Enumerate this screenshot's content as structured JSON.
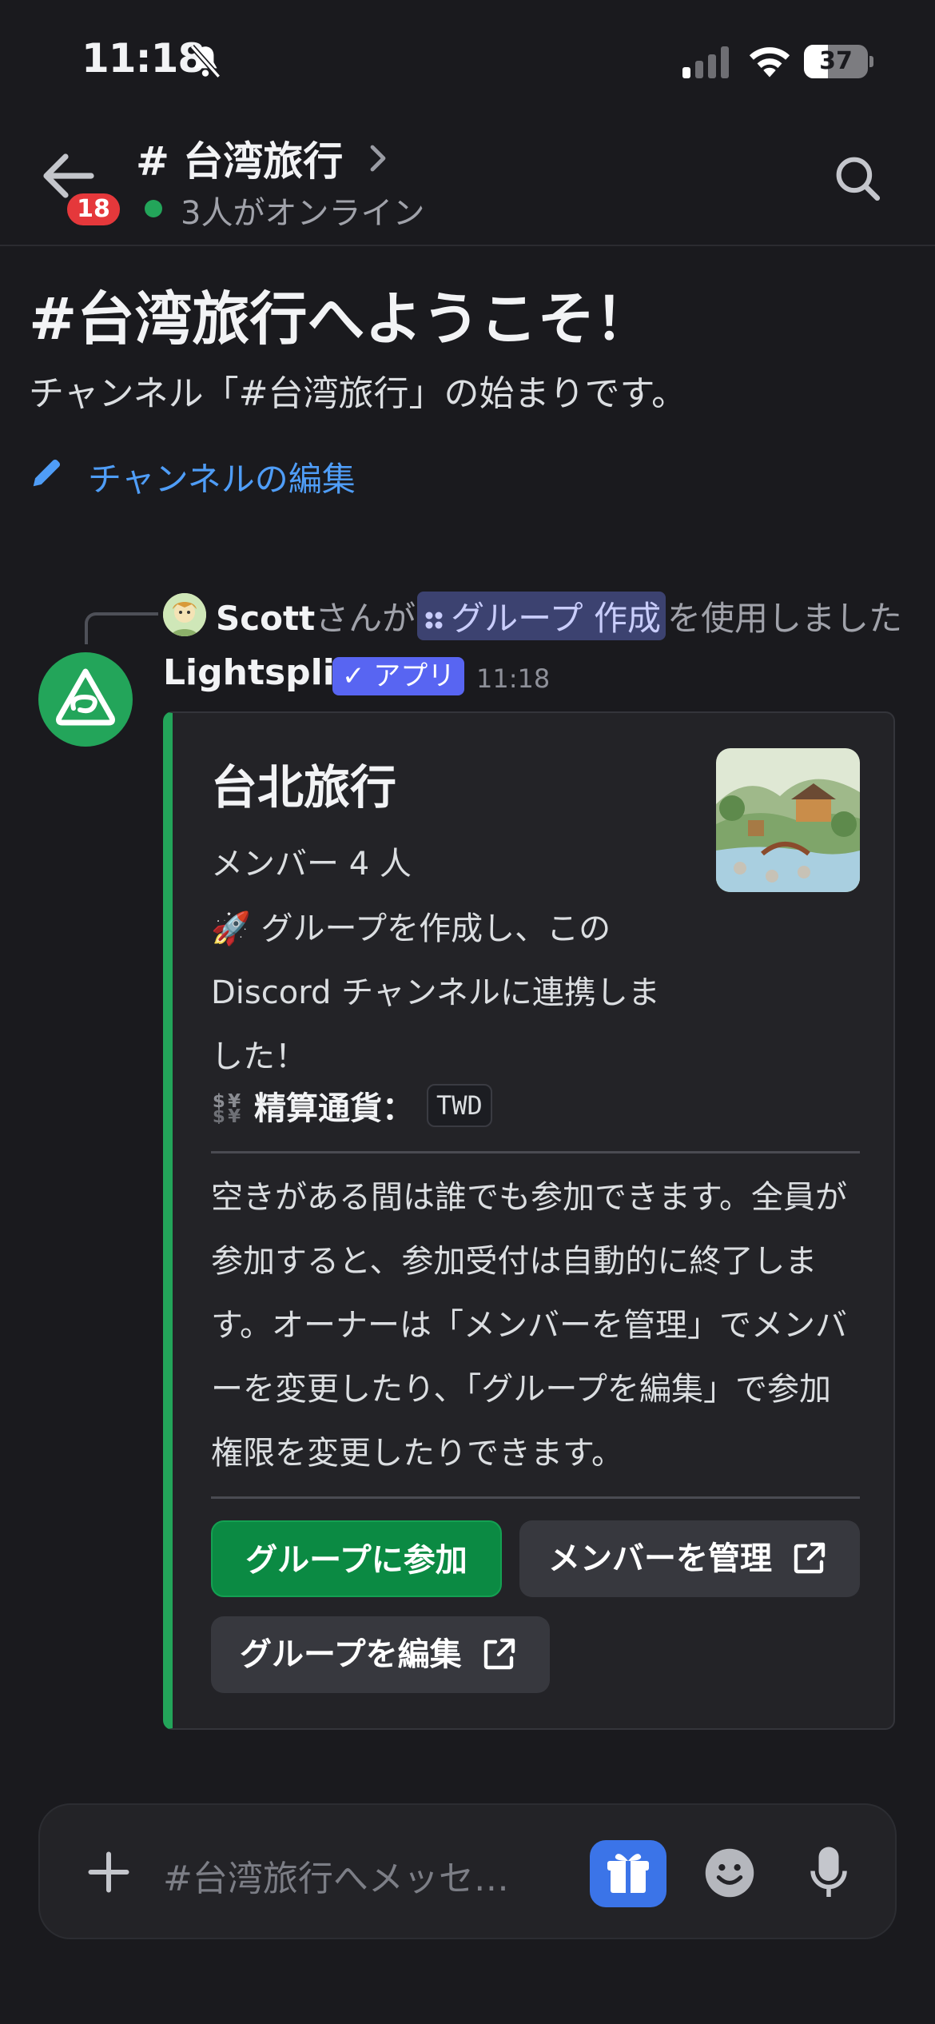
{
  "status_bar": {
    "time": "11:18",
    "battery": "37",
    "battery_level": 0.37
  },
  "header": {
    "unread_badge": "18",
    "channel_title": "# 台湾旅行",
    "online_text": "3人がオンライン"
  },
  "welcome": {
    "title": "#台湾旅行へようこそ！",
    "subtitle": "チャンネル「#台湾旅行」の始まりです。",
    "edit_link": "チャンネルの編集"
  },
  "system_line": {
    "user": "Scott",
    "suffix_1": "さんが",
    "command": "グループ 作成",
    "suffix_2": "を使用しました"
  },
  "message": {
    "author": "Lightsplit",
    "app_tag": "✓ アプリ",
    "time": "11:18",
    "embed": {
      "title": "台北旅行",
      "members": "メンバー 4 人",
      "description": "🚀 グループを作成し、この Discord チャンネルに連携しました！",
      "field_label": "精算通貨：",
      "field_value": "TWD",
      "body": "空きがある間は誰でも参加できます。全員が参加すると、参加受付は自動的に終了します。オーナーは「メンバーを管理」でメンバーを変更したり、「グループを編集」で参加権限を変更したりできます。",
      "buttons": {
        "join": "グループに参加",
        "manage": "メンバーを管理",
        "edit": "グループを編集"
      }
    }
  },
  "composer": {
    "placeholder": "#台湾旅行へメッセ…"
  },
  "colors": {
    "background": "#1a1a1e",
    "accent_green": "#23a55a",
    "link_blue": "#4f9df7",
    "app_tag": "#5865f2",
    "badge_red": "#e5383b"
  },
  "icons": [
    "back-arrow-icon",
    "search-icon",
    "pencil-icon",
    "plus-icon",
    "gift-icon",
    "emoji-icon",
    "microphone-icon",
    "external-link-icon",
    "bell-slash-icon",
    "wifi-icon",
    "signal-icon",
    "currency-icon"
  ]
}
